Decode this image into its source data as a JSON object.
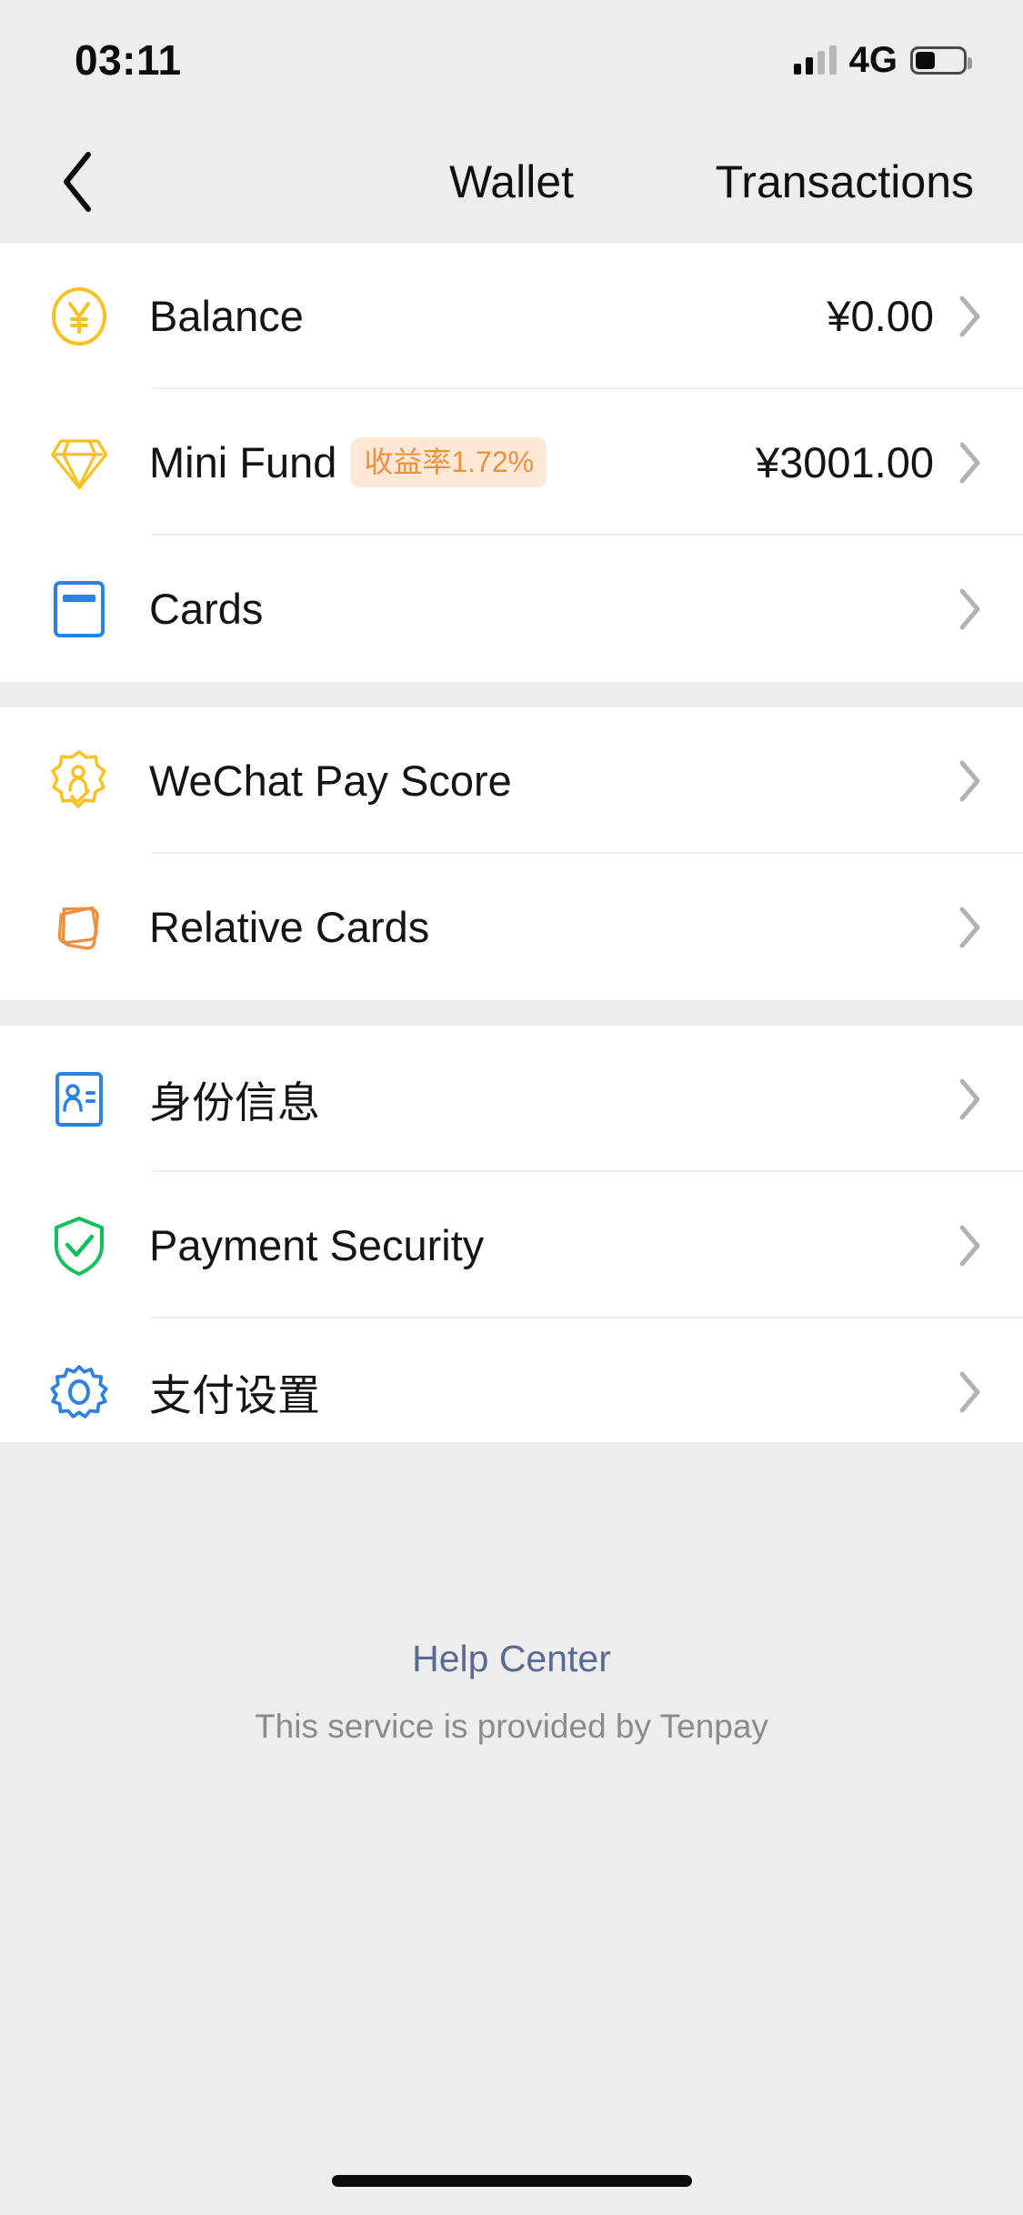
{
  "status_bar": {
    "time": "03:11",
    "network": "4G",
    "signal_bars_filled": 2,
    "signal_bars_total": 4,
    "battery_percent": 42
  },
  "nav": {
    "back_icon": "chevron-left-icon",
    "title": "Wallet",
    "right_action": "Transactions"
  },
  "groups": [
    {
      "rows": [
        {
          "icon": "yuan-coin-icon",
          "label": "Balance",
          "badge": "",
          "value": "¥0.00",
          "chevron": true
        },
        {
          "icon": "diamond-icon",
          "label": "Mini Fund",
          "badge": "收益率1.72%",
          "value": "¥3001.00",
          "chevron": true
        },
        {
          "icon": "bank-card-icon",
          "label": "Cards",
          "badge": "",
          "value": "",
          "chevron": true
        }
      ]
    },
    {
      "rows": [
        {
          "icon": "pay-score-badge-icon",
          "label": "WeChat Pay Score",
          "badge": "",
          "value": "",
          "chevron": true
        },
        {
          "icon": "relative-cards-icon",
          "label": "Relative Cards",
          "badge": "",
          "value": "",
          "chevron": true
        }
      ]
    },
    {
      "rows": [
        {
          "icon": "id-card-icon",
          "label": "身份信息",
          "badge": "",
          "value": "",
          "chevron": true
        },
        {
          "icon": "shield-check-icon",
          "label": "Payment Security",
          "badge": "",
          "value": "",
          "chevron": true
        },
        {
          "icon": "gear-icon",
          "label": "支付设置",
          "badge": "",
          "value": "",
          "chevron": true
        }
      ]
    }
  ],
  "footer": {
    "help_center": "Help Center",
    "provider_note": "This service is provided by Tenpay"
  },
  "colors": {
    "page_background": "#ededed",
    "card_background": "#ffffff",
    "primary_text": "#141414",
    "secondary_text": "#8b8b8b",
    "link": "#586a93",
    "yellow": "#f7c122",
    "orange": "#ef8f3c",
    "blue": "#2b82e4",
    "green": "#13bf5f",
    "badge_background": "#fce8d5"
  }
}
